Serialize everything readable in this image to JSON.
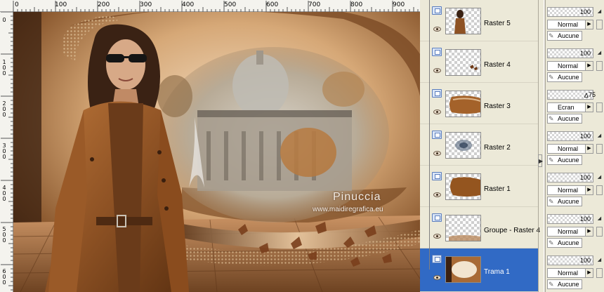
{
  "ruler": {
    "top_labels": [
      "0",
      "100",
      "200",
      "300",
      "400",
      "500",
      "600",
      "700",
      "800",
      "900"
    ],
    "left_labels": [
      "0",
      "100",
      "200",
      "300",
      "400",
      "500",
      "600"
    ]
  },
  "image": {
    "watermark_title": "Pinuccia",
    "watermark_url": "www.maidiregrafica.eu"
  },
  "layers": [
    {
      "name": "Raster 5",
      "thumb": "woman-figure",
      "selected": false,
      "opacity": "100",
      "blend": "Normal",
      "mask": "Aucune"
    },
    {
      "name": "Raster 4",
      "thumb": "leaves",
      "selected": false,
      "opacity": "100",
      "blend": "Normal",
      "mask": "Aucune"
    },
    {
      "name": "Raster 3",
      "thumb": "brown-arc",
      "selected": false,
      "opacity": "75",
      "blend": "Ecran",
      "mask": "Aucune"
    },
    {
      "name": "Raster 2",
      "thumb": "blue-blur",
      "selected": false,
      "opacity": "100",
      "blend": "Normal",
      "mask": "Aucune"
    },
    {
      "name": "Raster 1",
      "thumb": "brown-arc",
      "selected": false,
      "opacity": "100",
      "blend": "Normal",
      "mask": "Aucune"
    },
    {
      "name": "Groupe - Raster 4",
      "thumb": "leaves-bottom",
      "selected": false,
      "opacity": "100",
      "blend": "Normal",
      "mask": "Aucune"
    },
    {
      "name": "Trama 1",
      "thumb": "background",
      "selected": true,
      "opacity": "100",
      "blend": "Normal",
      "mask": "Aucune"
    }
  ],
  "colors": {
    "selection": "#316ac5",
    "panel_bg": "#ece9d8",
    "image_brown": "#8a5a32"
  }
}
